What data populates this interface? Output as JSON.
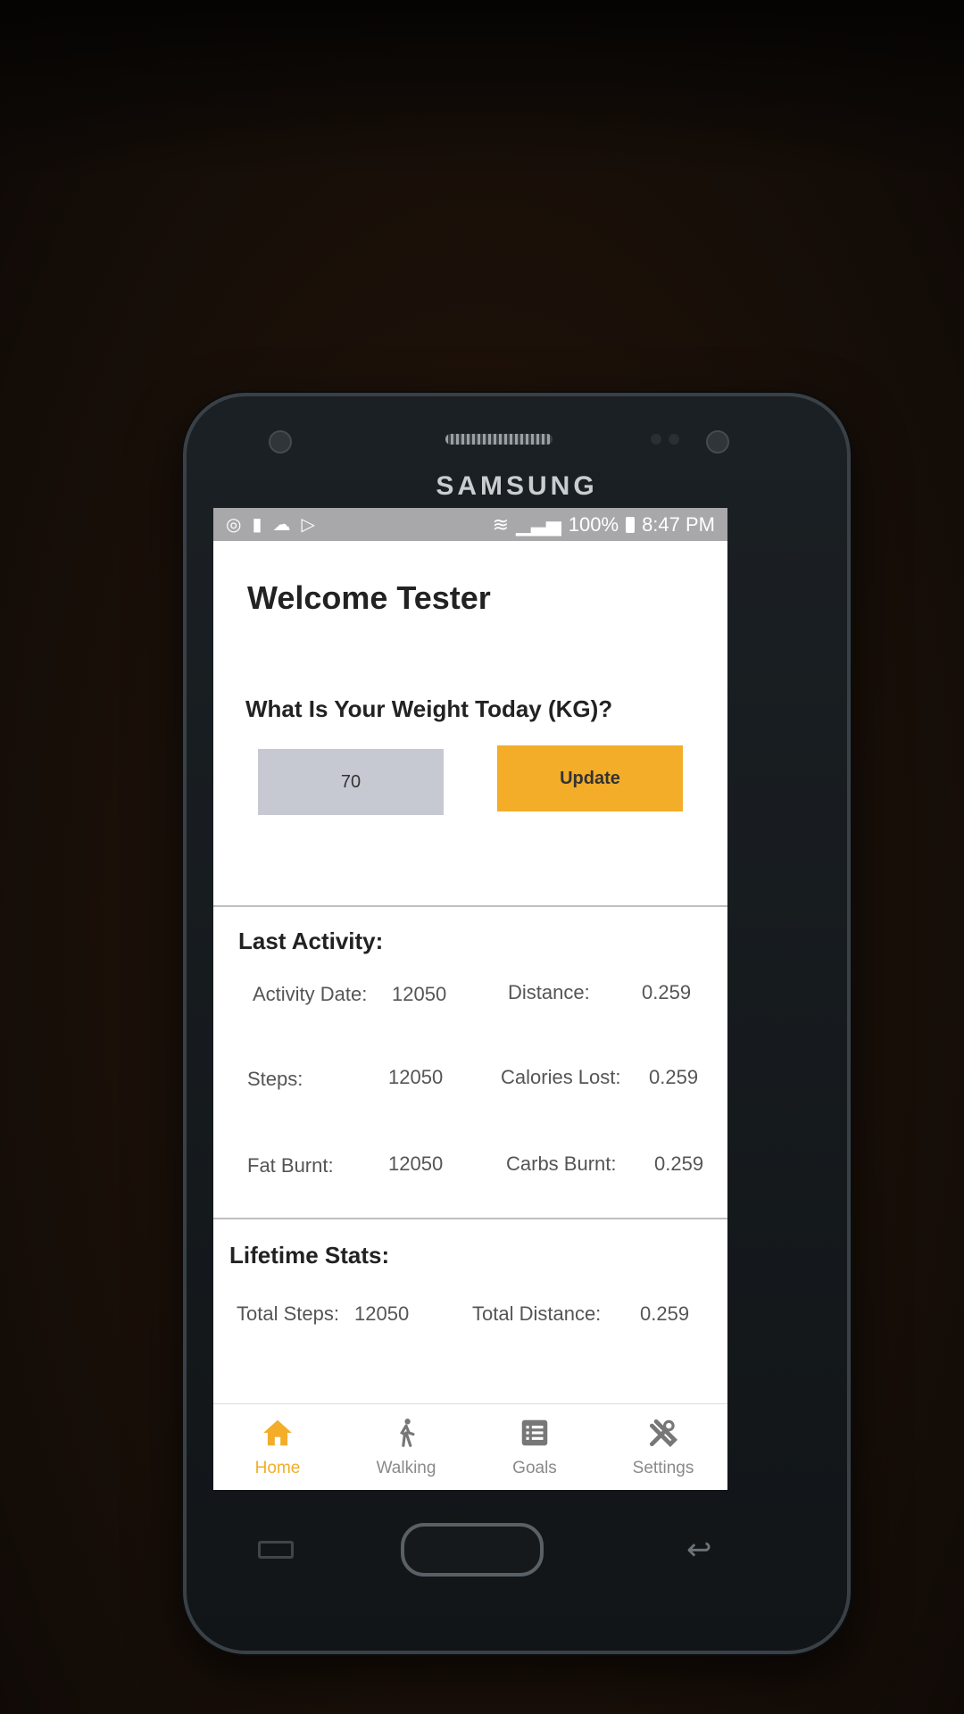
{
  "device": {
    "brand": "SAMSUNG"
  },
  "status_bar": {
    "left_icons": [
      "settings-circle-icon",
      "lock-icon",
      "cloud-icon",
      "play-icon"
    ],
    "battery_percent": "100%",
    "time": "8:47 PM"
  },
  "header": {
    "title": "Welcome Tester"
  },
  "weight": {
    "question": "What Is Your Weight Today (KG)?",
    "value": "70",
    "button_label": "Update"
  },
  "last_activity": {
    "title": "Last Activity:",
    "items": [
      {
        "label": "Activity Date:",
        "value": "12050"
      },
      {
        "label": "Distance:",
        "value": "0.259"
      },
      {
        "label": "Steps:",
        "value": "12050"
      },
      {
        "label": "Calories Lost:",
        "value": "0.259"
      },
      {
        "label": "Fat Burnt:",
        "value": "12050"
      },
      {
        "label": "Carbs Burnt:",
        "value": "0.259"
      }
    ]
  },
  "lifetime_stats": {
    "title": "Lifetime Stats:",
    "items": [
      {
        "label": "Total Steps:",
        "value": "12050"
      },
      {
        "label": "Total Distance:",
        "value": "0.259"
      }
    ]
  },
  "nav": {
    "active": "Home",
    "items": [
      {
        "label": "Home",
        "icon": "home-icon"
      },
      {
        "label": "Walking",
        "icon": "walking-icon"
      },
      {
        "label": "Goals",
        "icon": "list-icon"
      },
      {
        "label": "Settings",
        "icon": "tools-icon"
      }
    ]
  },
  "colors": {
    "accent": "#f3ad29",
    "input_bg": "#c6c8d2",
    "status_bar": "#a8a8aa"
  }
}
